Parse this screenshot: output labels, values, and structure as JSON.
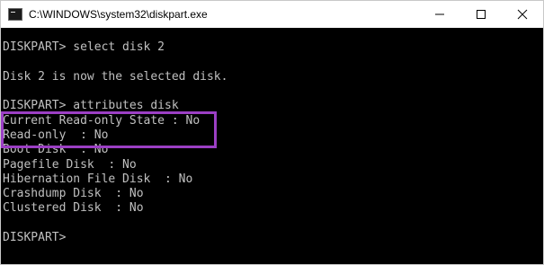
{
  "window": {
    "title": "C:\\WINDOWS\\system32\\diskpart.exe",
    "icon": "console-icon",
    "controls": [
      "minimize-icon",
      "maximize-icon",
      "close-icon"
    ]
  },
  "console": {
    "lines": [
      "DISKPART> select disk 2",
      "",
      "Disk 2 is now the selected disk.",
      "",
      "DISKPART> attributes disk",
      "Current Read-only State : No",
      "Read-only  : No",
      "Boot Disk  : No",
      "Pagefile Disk  : No",
      "Hibernation File Disk  : No",
      "Crashdump Disk  : No",
      "Clustered Disk  : No",
      "",
      "DISKPART>"
    ],
    "text_color": "#c0c0c0",
    "background": "#000000"
  },
  "annotation": {
    "highlight_color": "#9b3fc4"
  }
}
